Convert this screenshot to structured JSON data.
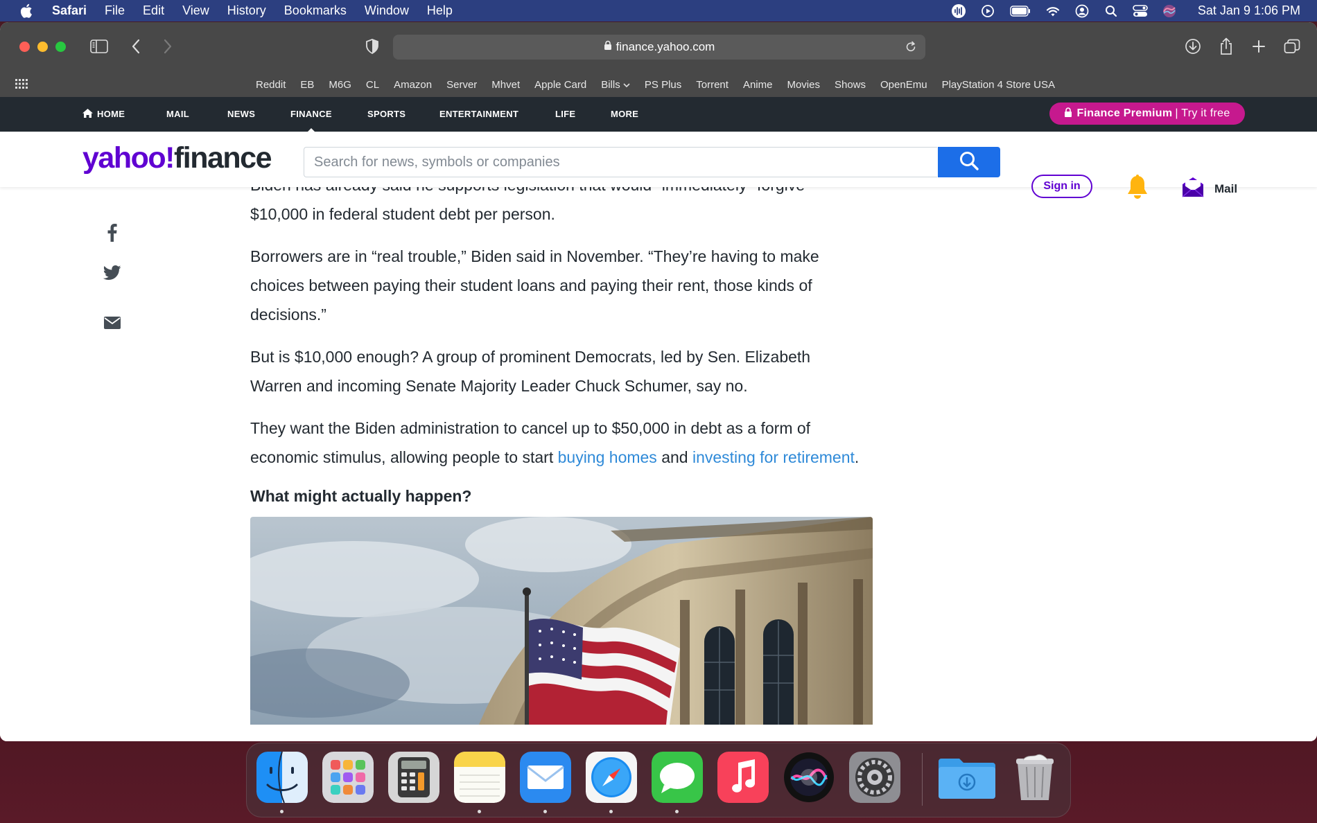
{
  "menubar": {
    "app_name": "Safari",
    "menus": [
      "File",
      "Edit",
      "View",
      "History",
      "Bookmarks",
      "Window",
      "Help"
    ],
    "clock": "Sat Jan 9  1:06 PM"
  },
  "browser": {
    "url": "finance.yahoo.com",
    "favorites": [
      "Reddit",
      "EB",
      "M6G",
      "CL",
      "Amazon",
      "Server",
      "Mhvet",
      "Apple Card",
      "Bills",
      "PS Plus",
      "Torrent",
      "Anime",
      "Movies",
      "Shows",
      "OpenEmu",
      "PlayStation 4 Store USA"
    ]
  },
  "yahoo_nav": {
    "items": [
      "HOME",
      "MAIL",
      "NEWS",
      "FINANCE",
      "SPORTS",
      "ENTERTAINMENT",
      "LIFE",
      "MORE"
    ],
    "active": "FINANCE",
    "premium_bold": "Finance Premium",
    "premium_rest": "| Try it free"
  },
  "header": {
    "logo_yahoo": "yahoo!",
    "logo_finance": "finance",
    "search_placeholder": "Search for news, symbols or companies",
    "signin_label": "Sign in",
    "mail_label": "Mail"
  },
  "article": {
    "p0_partial": "Biden has already said he supports legislation that would \"immediately\" forgive",
    "p0_end": "$10,000 in federal student debt per person.",
    "p1": "Borrowers are in “real trouble,” Biden said in November. “They’re having to make choices between paying their student loans and paying their rent, those kinds of decisions.”",
    "p2": "But is $10,000 enough? A group of prominent Democrats, led by Sen. Elizabeth Warren and incoming Senate Majority Leader Chuck Schumer, say no.",
    "p3_start": "They want the Biden administration to cancel up to $50,000 in debt as a form of economic stimulus, allowing people to start ",
    "p3_link1": "buying homes",
    "p3_mid": " and ",
    "p3_link2": "investing for retirement",
    "p3_end": ".",
    "subheading": "What might actually happen?"
  },
  "dock": {
    "apps": [
      "finder-icon",
      "launchpad-icon",
      "calculator-icon",
      "notes-icon",
      "mail-icon",
      "safari-icon",
      "messages-icon",
      "music-icon",
      "siri-icon",
      "system-preferences-icon",
      "downloads-folder-icon",
      "trash-icon"
    ]
  },
  "colors": {
    "yahoo_purple": "#6001d2",
    "premium_pink": "#c6198e",
    "search_blue": "#1c6ee8",
    "link_blue": "#2f8ad8",
    "nav_dark": "#232a31"
  }
}
